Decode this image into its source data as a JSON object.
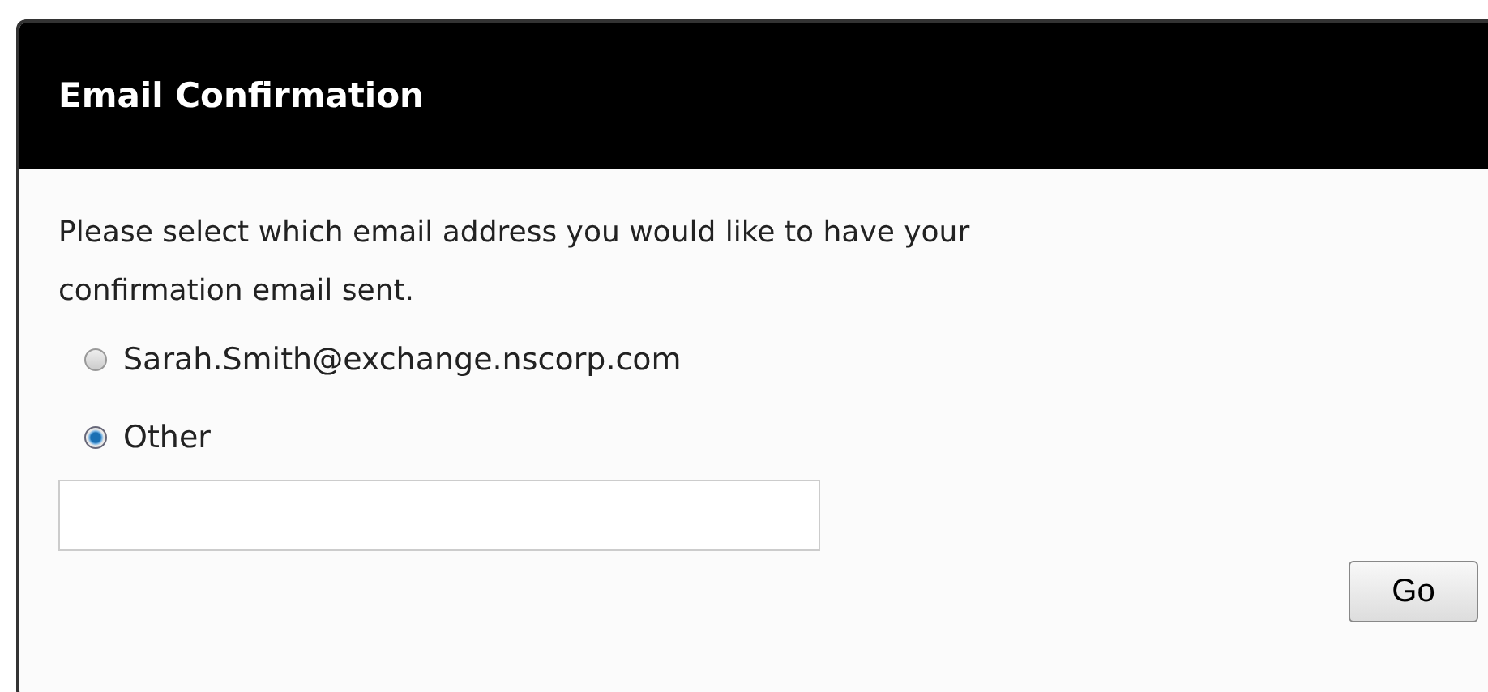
{
  "dialog": {
    "title": "Email Confirmation",
    "message": "Please select which email address you would like to have your confirmation email sent.",
    "options": [
      {
        "label": "Sarah.Smith@exchange.nscorp.com",
        "selected": false
      },
      {
        "label": "Other",
        "selected": true
      }
    ],
    "buttons": [
      "Go"
    ]
  }
}
